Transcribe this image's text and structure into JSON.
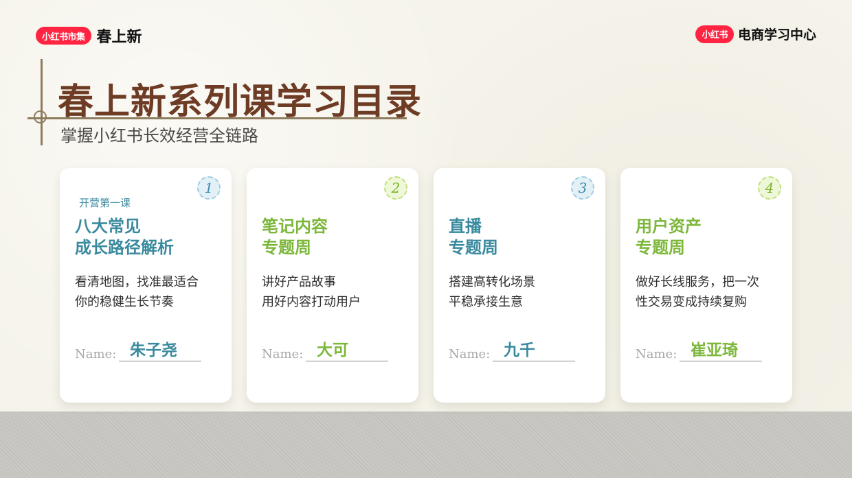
{
  "brand_left": {
    "pill": "小红书市集",
    "text": "春上新"
  },
  "brand_right": {
    "pill": "小红书",
    "text": "电商学习中心"
  },
  "title": "春上新系列课学习目录",
  "subtitle": "掌握小红书长效经营全链路",
  "colors": {
    "brand": "#ff2442",
    "title": "#6e3b24",
    "blue": "#3a8a9e",
    "green": "#7cb73a"
  },
  "cards": [
    {
      "number": "1",
      "tag": "开营第一课",
      "title_line1": "八大常见",
      "title_line2": "成长路径解析",
      "desc_line1": "看清地图，找准最适合",
      "desc_line2": "你的稳健生长节奏",
      "name_label": "Name:",
      "name": "朱子尧",
      "accent": "blue"
    },
    {
      "number": "2",
      "tag": "",
      "title_line1": "笔记内容",
      "title_line2": "专题周",
      "desc_line1": "讲好产品故事",
      "desc_line2": "用好内容打动用户",
      "name_label": "Name:",
      "name": "大可",
      "accent": "green"
    },
    {
      "number": "3",
      "tag": "",
      "title_line1": "直播",
      "title_line2": "专题周",
      "desc_line1": "搭建高转化场景",
      "desc_line2": "平稳承接生意",
      "name_label": "Name:",
      "name": "九千",
      "accent": "blue"
    },
    {
      "number": "4",
      "tag": "",
      "title_line1": "用户资产",
      "title_line2": "专题周",
      "desc_line1": "做好长线服务，把一次",
      "desc_line2": "性交易变成持续复购",
      "name_label": "Name:",
      "name": "崔亚琦",
      "accent": "green"
    }
  ]
}
